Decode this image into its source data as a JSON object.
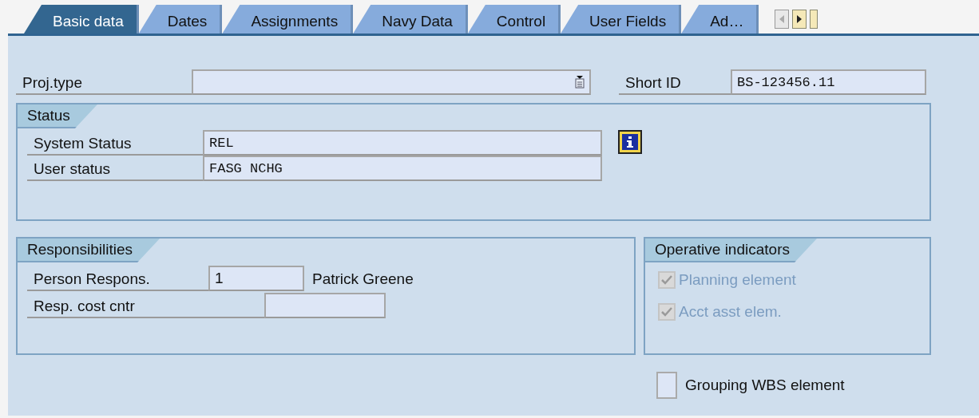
{
  "tabs": [
    {
      "label": "Basic data",
      "selected": true
    },
    {
      "label": "Dates",
      "selected": false
    },
    {
      "label": "Assignments",
      "selected": false
    },
    {
      "label": "Navy Data",
      "selected": false
    },
    {
      "label": "Control",
      "selected": false
    },
    {
      "label": "User Fields",
      "selected": false
    },
    {
      "label": "Ad…",
      "selected": false
    }
  ],
  "project_type": {
    "label": "Proj.type"
  },
  "short_id": {
    "label": "Short ID",
    "value": "BS-123456.11"
  },
  "status": {
    "title": "Status",
    "fields": [
      {
        "label": "System Status",
        "value": "REL"
      },
      {
        "label": "User status",
        "value": "FASG NCHG"
      }
    ]
  },
  "responsibilities": {
    "title": "Responsibilities",
    "fields": [
      {
        "label": "Person Respons.",
        "value": "1",
        "description": "Patrick Greene"
      },
      {
        "label": "Resp. cost cntr"
      }
    ]
  },
  "operative_indicators": {
    "title": "Operative indicators",
    "checkboxes": [
      {
        "label": "Planning element",
        "checked": true,
        "disabled": true
      },
      {
        "label": "Acct asst elem.",
        "checked": true,
        "disabled": true
      }
    ]
  },
  "grouping": {
    "label": "Grouping WBS element",
    "checked": false,
    "disabled": false
  }
}
